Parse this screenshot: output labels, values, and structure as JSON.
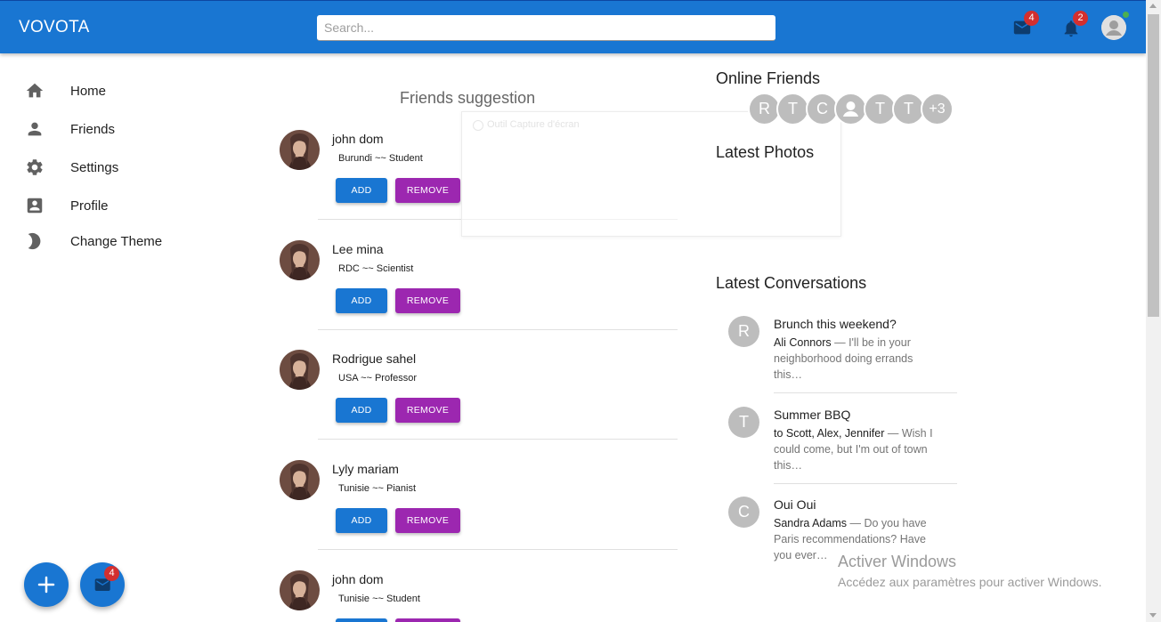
{
  "appbar": {
    "brand": "VOVOTA",
    "search_placeholder": "Search...",
    "mail_badge": "4",
    "notifications_badge": "2"
  },
  "sidebar": {
    "items": [
      {
        "label": "Home",
        "icon": "home-icon"
      },
      {
        "label": "Friends",
        "icon": "person-icon"
      },
      {
        "label": "Settings",
        "icon": "gear-icon"
      },
      {
        "label": "Profile",
        "icon": "account-box-icon"
      },
      {
        "label": "Change Theme",
        "icon": "moon-icon"
      }
    ]
  },
  "friends_suggestion": {
    "title": "Friends suggestion",
    "add_label": "ADD",
    "remove_label": "REMOVE",
    "items": [
      {
        "name": "john dom",
        "subtitle": "Burundi ~~ Student"
      },
      {
        "name": "Lee mina",
        "subtitle": "RDC ~~ Scientist"
      },
      {
        "name": "Rodrigue sahel",
        "subtitle": "USA ~~ Professor"
      },
      {
        "name": "Lyly mariam",
        "subtitle": "Tunisie ~~ Pianist"
      },
      {
        "name": "john dom",
        "subtitle": "Tunisie ~~ Student"
      }
    ]
  },
  "overlay": {
    "text": "Outil Capture d'écran"
  },
  "online_friends": {
    "title": "Online Friends",
    "avatars": [
      "R",
      "T",
      "C",
      "",
      "T",
      "T",
      "+3"
    ]
  },
  "latest_photos": {
    "title": "Latest Photos"
  },
  "latest_conversations": {
    "title": "Latest Conversations",
    "items": [
      {
        "initial": "R",
        "title": "Brunch this weekend?",
        "who": "Ali Connors",
        "text": " — I'll be in your neighborhood doing errands this…"
      },
      {
        "initial": "T",
        "title": "Summer BBQ",
        "who": "to Scott, Alex, Jennifer",
        "text": " — Wish I could come, but I'm out of town this…"
      },
      {
        "initial": "C",
        "title": "Oui Oui",
        "who": "Sandra Adams",
        "text": " — Do you have Paris recommendations? Have you ever…"
      }
    ]
  },
  "watermark": {
    "line1": "Activer Windows",
    "line2": "Accédez aux paramètres pour activer Windows."
  },
  "fab": {
    "mail_badge": "4"
  },
  "colors": {
    "primary": "#1976d2",
    "secondary": "#9c27b0",
    "badge": "#d32f2f"
  }
}
